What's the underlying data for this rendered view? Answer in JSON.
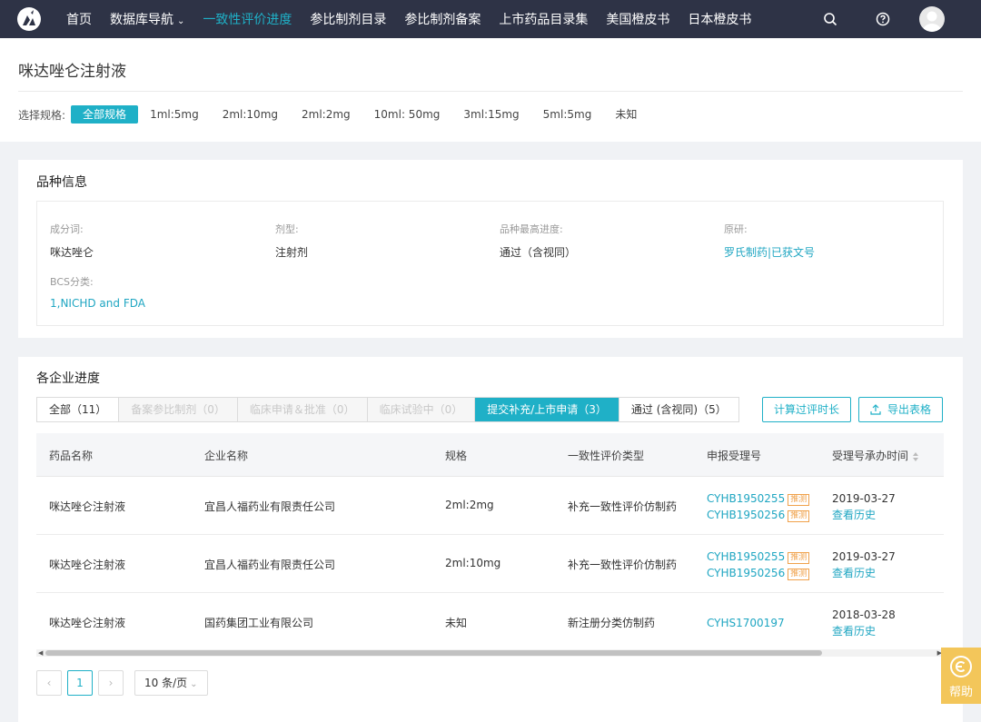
{
  "nav": {
    "items": [
      {
        "label": "首页"
      },
      {
        "label": "数据库导航",
        "caret": "⌄"
      },
      {
        "label": "一致性评价进度"
      },
      {
        "label": "参比制剂目录"
      },
      {
        "label": "参比制剂备案"
      },
      {
        "label": "上市药品目录集"
      },
      {
        "label": "美国橙皮书"
      },
      {
        "label": "日本橙皮书"
      }
    ],
    "active_index": 2,
    "icons": [
      "search-icon",
      "help-circle-icon",
      "avatar"
    ]
  },
  "page": {
    "title": "咪达唑仑注射液",
    "spec_label": "选择规格:",
    "specs": [
      "全部规格",
      "1ml:5mg",
      "2ml:10mg",
      "2ml:2mg",
      "10ml: 50mg",
      "3ml:15mg",
      "5ml:5mg",
      "未知"
    ],
    "active_spec": 0
  },
  "variety": {
    "title": "品种信息",
    "fields": {
      "ingredient": {
        "label": "成分词:",
        "value": "咪达唑仑"
      },
      "dosage_form": {
        "label": "剂型:",
        "value": "注射剂"
      },
      "highest_progress": {
        "label": "品种最高进度:",
        "value": "通过（含视同）"
      },
      "original": {
        "label": "原研:",
        "value": "罗氏制药|已获文号"
      },
      "bcs": {
        "label": "BCS分类:",
        "value": "1,NICHD and FDA"
      }
    }
  },
  "progress": {
    "title": "各企业进度",
    "tabs": [
      {
        "label": "全部（11）",
        "state": "normal"
      },
      {
        "label": "备案参比制剂（0）",
        "state": "disabled"
      },
      {
        "label": "临床申请＆批准（0）",
        "state": "disabled"
      },
      {
        "label": "临床试验中（0）",
        "state": "disabled"
      },
      {
        "label": "提交补充/上市申请（3）",
        "state": "active"
      },
      {
        "label": "通过 (含视同)（5）",
        "state": "normal"
      }
    ],
    "calc_button": "计算过评时长",
    "export_button": "导出表格",
    "columns": [
      "药品名称",
      "企业名称",
      "规格",
      "一致性评价类型",
      "申报受理号",
      "受理号承办时间"
    ],
    "rows": [
      {
        "drug": "咪达唑仑注射液",
        "company": "宜昌人福药业有限责任公司",
        "spec": "2ml:2mg",
        "type": "补充一致性评价仿制药",
        "numbers": [
          {
            "no": "CYHB1950255",
            "tag": "推测"
          },
          {
            "no": "CYHB1950256",
            "tag": "推测"
          }
        ],
        "date": "2019-03-27",
        "history": "查看历史"
      },
      {
        "drug": "咪达唑仑注射液",
        "company": "宜昌人福药业有限责任公司",
        "spec": "2ml:10mg",
        "type": "补充一致性评价仿制药",
        "numbers": [
          {
            "no": "CYHB1950255",
            "tag": "推测"
          },
          {
            "no": "CYHB1950256",
            "tag": "推测"
          }
        ],
        "date": "2019-03-27",
        "history": "查看历史"
      },
      {
        "drug": "咪达唑仑注射液",
        "company": "国药集团工业有限公司",
        "spec": "未知",
        "type": "新注册分类仿制药",
        "numbers": [
          {
            "no": "CYHS1700197",
            "tag": ""
          }
        ],
        "date": "2018-03-28",
        "history": "查看历史"
      }
    ],
    "pagination": {
      "prev": "‹",
      "page": "1",
      "next": "›",
      "page_size": "10 条/页",
      "page_size_caret": "⌄"
    }
  },
  "help": {
    "label": "帮助"
  },
  "colors": {
    "nav_bg": "#2e3346",
    "accent": "#1fb0c7",
    "link": "#1fa6c2",
    "tag": "#f0a14a",
    "help_bg": "#f3c65a"
  }
}
